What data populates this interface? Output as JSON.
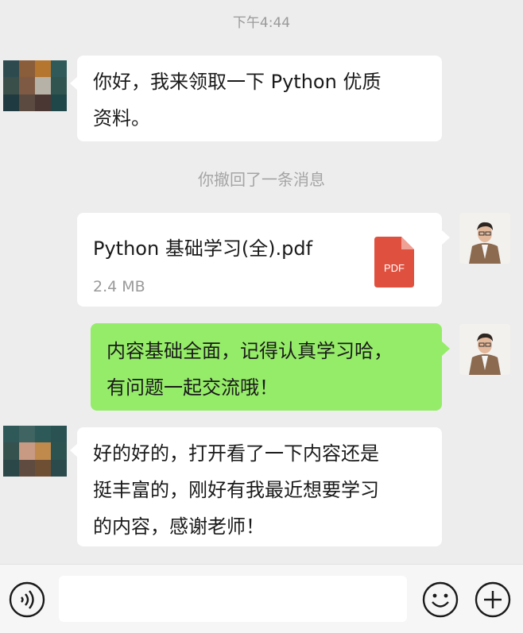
{
  "timestamp": "下午4:44",
  "system_notice": "你撤回了一条消息",
  "messages": [
    {
      "side": "left",
      "type": "text",
      "lines": [
        "你好，我来领取一下 Python 优质",
        "资料。"
      ]
    },
    {
      "side": "right",
      "type": "file",
      "file_name": "Python 基础学习(全).pdf",
      "file_size": "2.4 MB",
      "file_icon_label": "PDF"
    },
    {
      "side": "right",
      "type": "text",
      "lines": [
        "内容基础全面，记得认真学习哈，",
        "有问题一起交流哦！"
      ]
    },
    {
      "side": "left",
      "type": "text",
      "lines": [
        "好的好的，打开看了一下内容还是",
        "挺丰富的，刚好有我最近想要学习",
        "的内容，感谢老师！"
      ]
    }
  ],
  "input_bar": {
    "voice_icon": "voice-icon",
    "emoji_icon": "emoji-icon",
    "plus_icon": "plus-icon",
    "input_value": ""
  },
  "colors": {
    "background": "#ededed",
    "sent_bubble": "#95ec69",
    "received_bubble": "#ffffff",
    "pdf_red": "#e0503f"
  }
}
